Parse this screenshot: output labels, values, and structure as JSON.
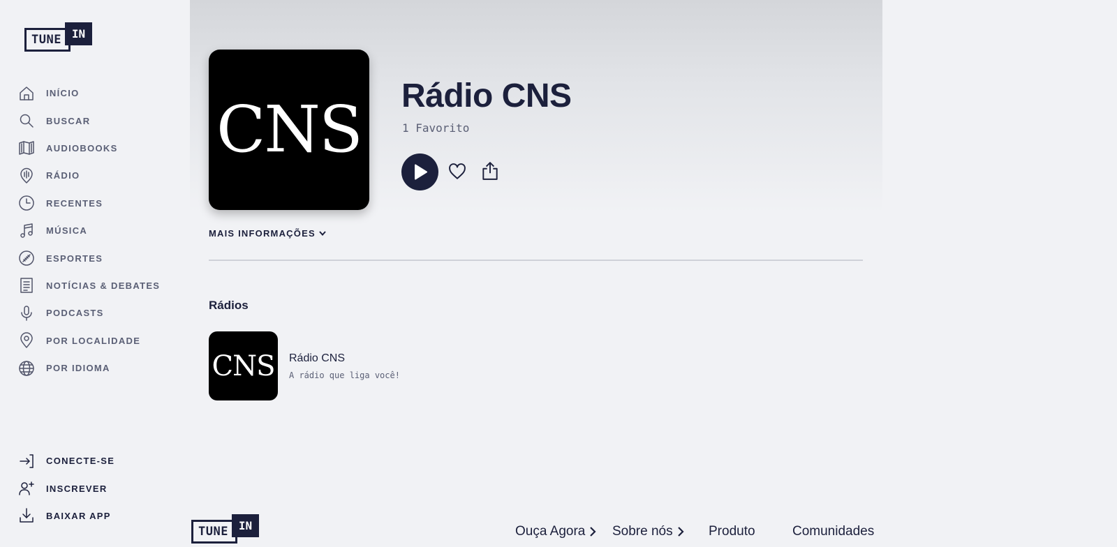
{
  "brand": {
    "tune": "TUNE",
    "in": "IN"
  },
  "sidebar": {
    "items": [
      {
        "label": "INÍCIO",
        "icon": "home-icon"
      },
      {
        "label": "BUSCAR",
        "icon": "search-icon"
      },
      {
        "label": "AUDIOBOOKS",
        "icon": "book-icon"
      },
      {
        "label": "RÁDIO",
        "icon": "radio-icon"
      },
      {
        "label": "RECENTES",
        "icon": "clock-icon"
      },
      {
        "label": "MÚSICA",
        "icon": "music-note-icon"
      },
      {
        "label": "ESPORTES",
        "icon": "sports-ball-icon"
      },
      {
        "label": "NOTÍCIAS & DEBATES",
        "icon": "news-icon"
      },
      {
        "label": "PODCASTS",
        "icon": "microphone-icon"
      },
      {
        "label": "POR LOCALIDADE",
        "icon": "location-pin-icon"
      },
      {
        "label": "POR IDIOMA",
        "icon": "globe-icon"
      }
    ],
    "bottom": [
      {
        "label": "CONECTE-SE",
        "icon": "login-icon"
      },
      {
        "label": "INSCREVER",
        "icon": "add-user-icon"
      },
      {
        "label": "BAIXAR APP",
        "icon": "download-icon"
      }
    ]
  },
  "station": {
    "artwork_text": "CNS",
    "title": "Rádio CNS",
    "favorites": "1 Favorito",
    "more_info": "MAIS INFORMAÇÕES"
  },
  "radios": {
    "section_title": "Rádios",
    "items": [
      {
        "artwork_text": "CNS",
        "title": "Rádio CNS",
        "subtitle": "A rádio que liga você!"
      }
    ]
  },
  "footer": {
    "links": [
      "Ouça Agora",
      "Sobre nós",
      "Produto",
      "Comunidades"
    ]
  },
  "colors": {
    "primary": "#1c203c",
    "background": "#f1f2f5",
    "muted": "#5a5f75"
  }
}
